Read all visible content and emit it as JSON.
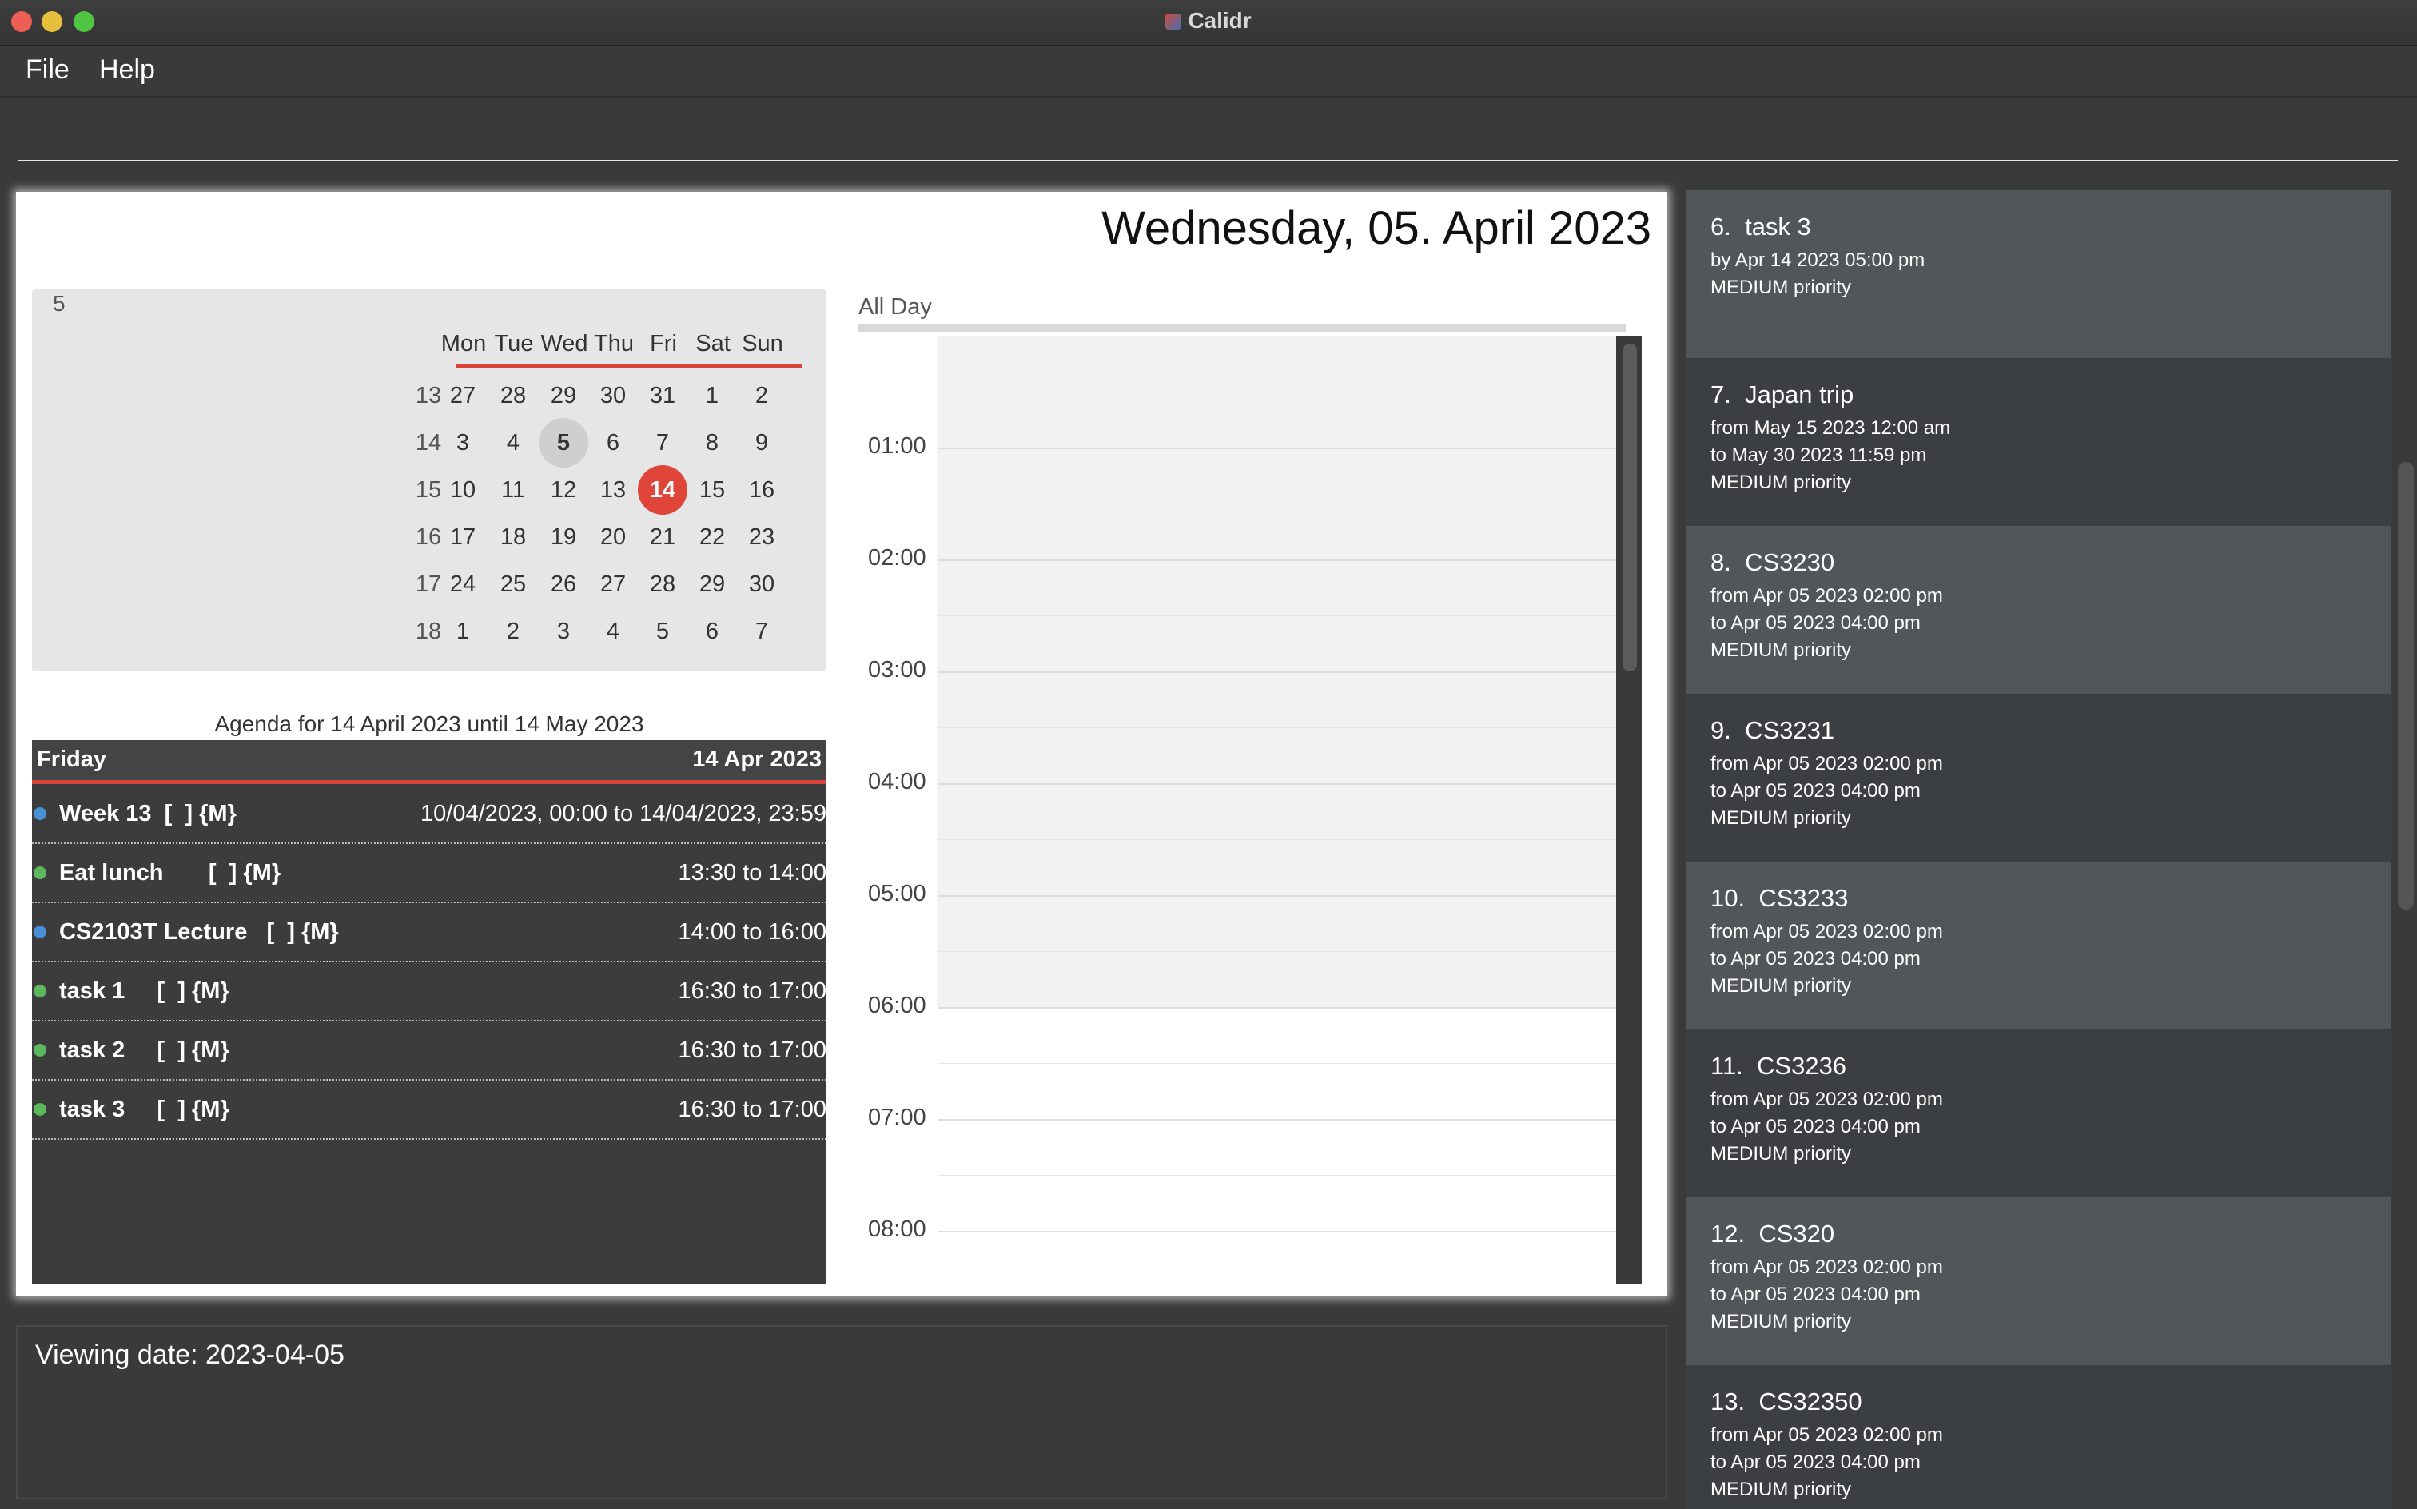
{
  "window": {
    "title": "Calidr",
    "traffic_lights": [
      "#ec5f57",
      "#e6bf3c",
      "#4fc542"
    ]
  },
  "menu": [
    "File",
    "Help"
  ],
  "command": {
    "value": ""
  },
  "calendar": {
    "date_header": "Wednesday, 05. April 2023",
    "month_number": "5",
    "weekdays": [
      "Mon",
      "Tue",
      "Wed",
      "Thu",
      "Fri",
      "Sat",
      "Sun"
    ],
    "weeks": [
      {
        "wk": "13",
        "days": [
          "27",
          "28",
          "29",
          "30",
          "31",
          "1",
          "2"
        ]
      },
      {
        "wk": "14",
        "days": [
          "3",
          "4",
          "5",
          "6",
          "7",
          "8",
          "9"
        ]
      },
      {
        "wk": "15",
        "days": [
          "10",
          "11",
          "12",
          "13",
          "14",
          "15",
          "16"
        ]
      },
      {
        "wk": "16",
        "days": [
          "17",
          "18",
          "19",
          "20",
          "21",
          "22",
          "23"
        ]
      },
      {
        "wk": "17",
        "days": [
          "24",
          "25",
          "26",
          "27",
          "28",
          "29",
          "30"
        ]
      },
      {
        "wk": "18",
        "days": [
          "1",
          "2",
          "3",
          "4",
          "5",
          "6",
          "7"
        ]
      }
    ],
    "selected_day": "5",
    "today_day": "14",
    "accent": "#e0453a"
  },
  "agenda": {
    "title": "Agenda for 14 April 2023 until 14 May 2023",
    "day": "Friday",
    "date": "14 Apr 2023",
    "items": [
      {
        "name": "Week 13  [  ] {M}",
        "time": "10/04/2023, 00:00 to 14/04/2023, 23:59",
        "dot": "#4a90d9"
      },
      {
        "name": "Eat lunch       [  ] {M}",
        "time": "13:30 to 14:00",
        "dot": "#5cb85c"
      },
      {
        "name": "CS2103T Lecture   [  ] {M}",
        "time": "14:00 to 16:00",
        "dot": "#4a90d9"
      },
      {
        "name": "task 1     [  ] {M}",
        "time": "16:30 to 17:00",
        "dot": "#5cb85c"
      },
      {
        "name": "task 2     [  ] {M}",
        "time": "16:30 to 17:00",
        "dot": "#5cb85c"
      },
      {
        "name": "task 3     [  ] {M}",
        "time": "16:30 to 17:00",
        "dot": "#5cb85c"
      }
    ]
  },
  "day_view": {
    "all_day_label": "All Day",
    "hours": [
      "01:00",
      "02:00",
      "03:00",
      "04:00",
      "05:00",
      "06:00",
      "07:00",
      "08:00"
    ]
  },
  "result": {
    "text": "Viewing date: 2023-04-05"
  },
  "tasks": [
    {
      "title": "6.  task 3",
      "lines": [
        "by Apr 14 2023 05:00 pm",
        "MEDIUM priority"
      ]
    },
    {
      "title": "7.  Japan trip",
      "lines": [
        "from May 15 2023 12:00 am",
        "to May 30 2023 11:59 pm",
        "MEDIUM priority"
      ]
    },
    {
      "title": "8.  CS3230",
      "lines": [
        "from Apr 05 2023 02:00 pm",
        "to Apr 05 2023 04:00 pm",
        "MEDIUM priority"
      ]
    },
    {
      "title": "9.  CS3231",
      "lines": [
        "from Apr 05 2023 02:00 pm",
        "to Apr 05 2023 04:00 pm",
        "MEDIUM priority"
      ]
    },
    {
      "title": "10.  CS3233",
      "lines": [
        "from Apr 05 2023 02:00 pm",
        "to Apr 05 2023 04:00 pm",
        "MEDIUM priority"
      ]
    },
    {
      "title": "11.  CS3236",
      "lines": [
        "from Apr 05 2023 02:00 pm",
        "to Apr 05 2023 04:00 pm",
        "MEDIUM priority"
      ]
    },
    {
      "title": "12.  CS320",
      "lines": [
        "from Apr 05 2023 02:00 pm",
        "to Apr 05 2023 04:00 pm",
        "MEDIUM priority"
      ]
    },
    {
      "title": "13.  CS32350",
      "lines": [
        "from Apr 05 2023 02:00 pm",
        "to Apr 05 2023 04:00 pm",
        "MEDIUM priority"
      ]
    }
  ],
  "task_card_colors": [
    "#515658",
    "#3c3f41"
  ]
}
